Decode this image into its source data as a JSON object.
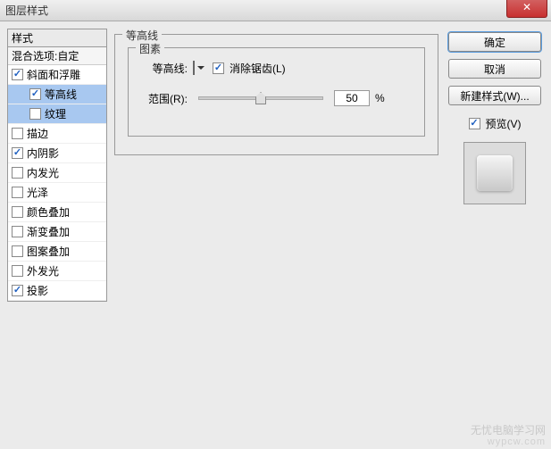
{
  "window": {
    "title": "图层样式"
  },
  "styles_panel": {
    "header": "样式",
    "blend": "混合选项:自定",
    "items": [
      {
        "label": "斜面和浮雕",
        "checked": true,
        "selected": false,
        "indent": false
      },
      {
        "label": "等高线",
        "checked": true,
        "selected": true,
        "indent": true
      },
      {
        "label": "纹理",
        "checked": false,
        "selected": true,
        "indent": true
      },
      {
        "label": "描边",
        "checked": false,
        "selected": false,
        "indent": false
      },
      {
        "label": "内阴影",
        "checked": true,
        "selected": false,
        "indent": false
      },
      {
        "label": "内发光",
        "checked": false,
        "selected": false,
        "indent": false
      },
      {
        "label": "光泽",
        "checked": false,
        "selected": false,
        "indent": false
      },
      {
        "label": "颜色叠加",
        "checked": false,
        "selected": false,
        "indent": false
      },
      {
        "label": "渐变叠加",
        "checked": false,
        "selected": false,
        "indent": false
      },
      {
        "label": "图案叠加",
        "checked": false,
        "selected": false,
        "indent": false
      },
      {
        "label": "外发光",
        "checked": false,
        "selected": false,
        "indent": false
      },
      {
        "label": "投影",
        "checked": true,
        "selected": false,
        "indent": false
      }
    ]
  },
  "center": {
    "group_title": "等高线",
    "elements_title": "图素",
    "contour_label": "等高线:",
    "antialias_label": "消除锯齿(L)",
    "antialias_checked": true,
    "range_label": "范围(R):",
    "range_value": "50",
    "range_unit": "%"
  },
  "right": {
    "ok": "确定",
    "cancel": "取消",
    "new_style": "新建样式(W)...",
    "preview_label": "预览(V)",
    "preview_checked": true
  },
  "watermark": {
    "line1": "无忧电脑学习网",
    "line2": "wypcw.com"
  }
}
